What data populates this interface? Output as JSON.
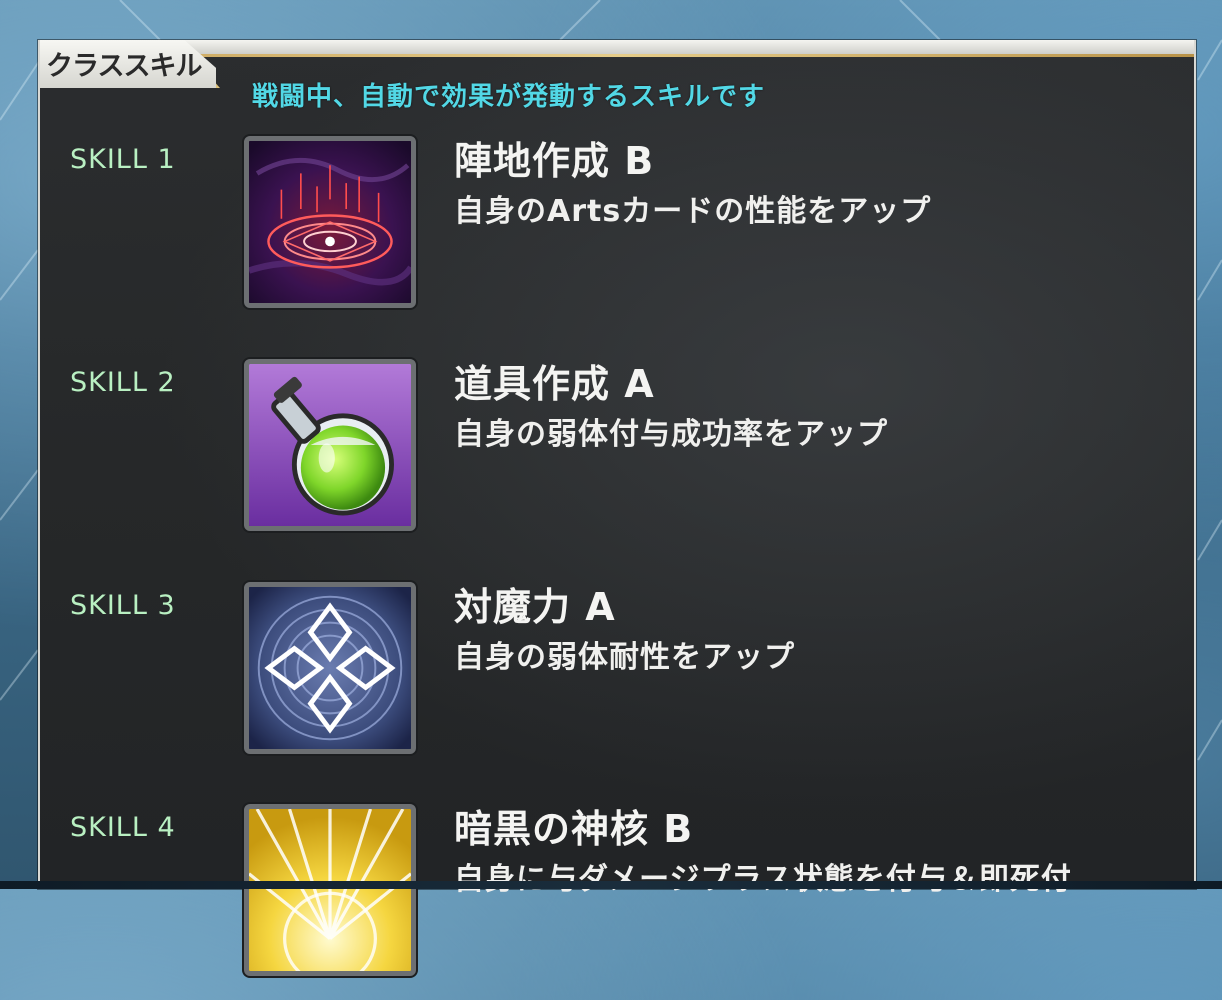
{
  "header": {
    "title": "クラススキル",
    "subtitle": "戦闘中、自動で効果が発動するスキルです"
  },
  "skills": [
    {
      "label": "SKILL 1",
      "name": "陣地作成 B",
      "description": "自身のArtsカードの性能をアップ",
      "icon": "magic-circle-icon"
    },
    {
      "label": "SKILL 2",
      "name": "道具作成 A",
      "description": "自身の弱体付与成功率をアップ",
      "icon": "potion-flask-icon"
    },
    {
      "label": "SKILL 3",
      "name": "対魔力 A",
      "description": "自身の弱体耐性をアップ",
      "icon": "anti-magic-diamond-icon"
    },
    {
      "label": "SKILL 4",
      "name": "暗黒の神核 B",
      "description": "自身に与ダメージプラス状態を付与＆即死付",
      "icon": "divine-core-burst-icon"
    }
  ],
  "colors": {
    "subtitle": "#52d8e6",
    "skill_label": "#b9f0c2",
    "panel_bg": "#262829",
    "gold_accent": "#d4b46a"
  }
}
